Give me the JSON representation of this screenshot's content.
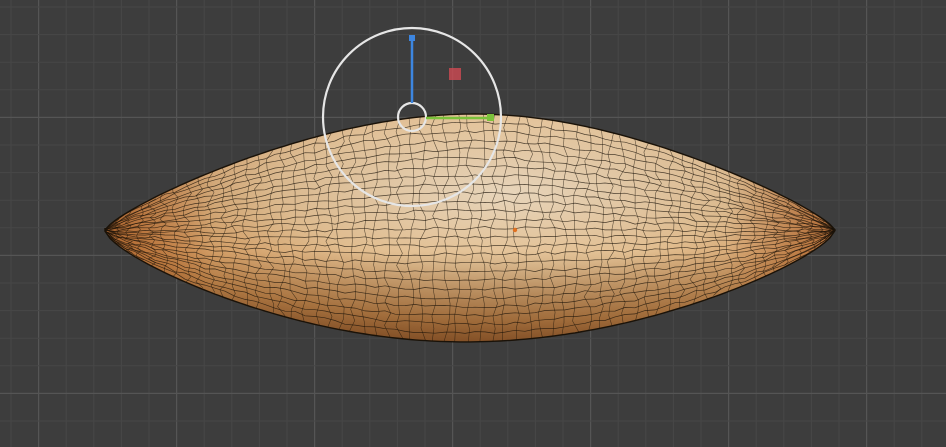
{
  "viewport": {
    "view": "front-orthographic",
    "background_color": "#3d3d3d",
    "grid_minor_color": "#474747",
    "grid_major_color": "#555555",
    "shading": "textured-wireframe-overlay"
  },
  "object": {
    "kind": "scanned-seed-mesh",
    "base_color": "#e7c79f",
    "shadow_color": "#b4773f",
    "rim_color": "#c8733a",
    "wire_color": "#1a1208"
  },
  "gizmo": {
    "type": "transform-gizmo",
    "ring_color": "#e6e6e6",
    "x_color": "#cf4a52",
    "y_color": "#7bc13a",
    "z_color": "#3d86e0"
  },
  "origin_color": "#e07020"
}
